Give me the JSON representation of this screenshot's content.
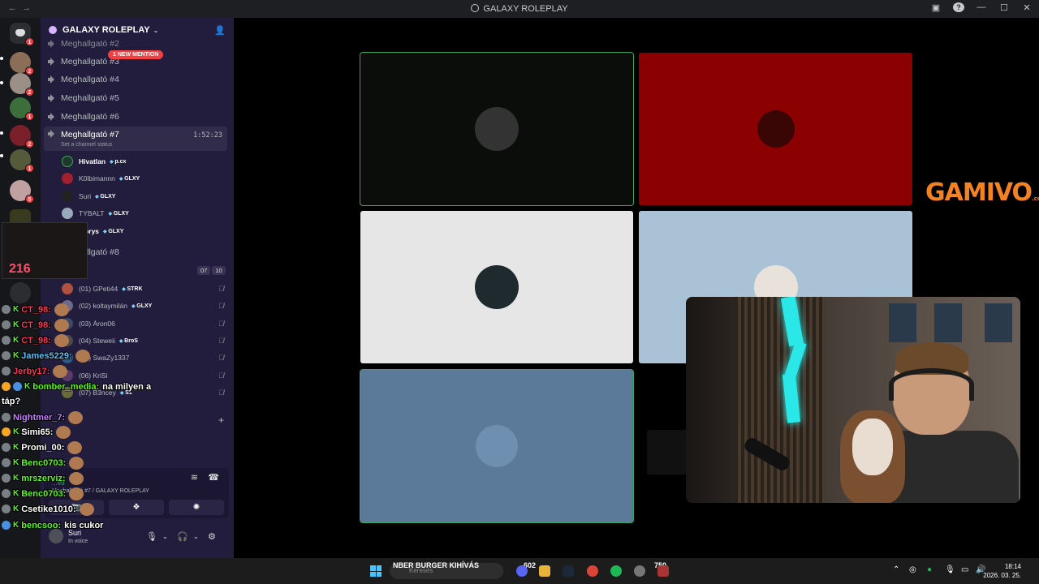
{
  "window": {
    "title": "GALAXY ROLEPLAY"
  },
  "server": {
    "name": "GALAXY ROLEPLAY",
    "new_mention": "1 NEW MENTION"
  },
  "rail": {
    "badges": [
      "1",
      "2",
      "2",
      "1",
      "2",
      "1",
      "5"
    ]
  },
  "channels": [
    {
      "name": "Meghallgató #2"
    },
    {
      "name": "Meghallgató #3"
    },
    {
      "name": "Meghallgató #4"
    },
    {
      "name": "Meghallgató #5"
    },
    {
      "name": "Meghallgató #6"
    },
    {
      "name": "Meghallgató #7",
      "time": "1:52:23",
      "status": "Set a channel status"
    },
    {
      "name": "Meghallgató #8"
    }
  ],
  "channel7_members": [
    {
      "name": "Hivatlan",
      "tag": "p.cx"
    },
    {
      "name": "K0lbimannn",
      "tag": "GLXY"
    },
    {
      "name": "Suri",
      "tag": "GLXY"
    },
    {
      "name": "TYBALT",
      "tag": "GLXY"
    },
    {
      "name": "...orys",
      "tag": "GLXY"
    }
  ],
  "channel8_counts": [
    "07",
    "10"
  ],
  "channel8_members": [
    {
      "name": "(01) GPeti44",
      "tag": "STRK"
    },
    {
      "name": "(02) koltaymilán",
      "tag": "GLXY"
    },
    {
      "name": "(03) Áron06",
      "tag": ""
    },
    {
      "name": "(04) Steweii",
      "tag": "BroS"
    },
    {
      "name": "(05) SwaZy1337",
      "tag": ""
    },
    {
      "name": "(06) KriSi",
      "tag": ""
    },
    {
      "name": "(07) B3ncey",
      "tag": "S1"
    }
  ],
  "voice_panel": {
    "connected": "...ed",
    "subtitle": "Meghallgató #7 / GALAXY ROLEPLAY"
  },
  "user": {
    "name": "Suri",
    "status": "In voice"
  },
  "chat": [
    {
      "user": "CT_98:",
      "color": "#ff3355",
      "msg": ""
    },
    {
      "user": "CT_98:",
      "color": "#ff3355",
      "msg": ""
    },
    {
      "user": "CT_98:",
      "color": "#ff3355",
      "msg": ""
    },
    {
      "user": "James5229:",
      "color": "#55c1ff",
      "msg": ""
    },
    {
      "user": "Jerby17:",
      "color": "#ff3355",
      "msg": ""
    },
    {
      "user": "bomber_media:",
      "color": "#53fc18",
      "msg": "na milyen a"
    },
    {
      "user": "táp?",
      "color": "#ffffff",
      "msg": ""
    },
    {
      "user": "Nightmer_7:",
      "color": "#c77dff",
      "msg": ""
    },
    {
      "user": "Simi65:",
      "color": "#ffffff",
      "msg": ""
    },
    {
      "user": "Promi_00:",
      "color": "#ffffff",
      "msg": ""
    },
    {
      "user": "Benc0703:",
      "color": "#53fc18",
      "msg": ""
    },
    {
      "user": "mrszerviz:",
      "color": "#53fc18",
      "msg": ""
    },
    {
      "user": "Benc0703:",
      "color": "#53fc18",
      "msg": ""
    },
    {
      "user": "Csetike1010:",
      "color": "#ffffff",
      "msg": ""
    },
    {
      "user": "bencsoo:",
      "color": "#53fc18",
      "msg": "kis cukor"
    }
  ],
  "alert": {
    "count": "216"
  },
  "brand": {
    "name": "GAMIVO",
    "suffix": ".com"
  },
  "taskbar": {
    "ticker": "NBER BURGER KIHÍVÁS",
    "search_placeholder": "Keresés",
    "counter_left": "602",
    "counter_right": "750",
    "time": "18:14",
    "date": "2026. 03. 25."
  },
  "colors": {
    "sidebar": "#221d3d",
    "speaking": "#3ba55d",
    "tile_red": "#8b0000",
    "tile_light": "#e6e6e6",
    "tile_sky": "#a9c2d6",
    "tile_slate": "#5b7a9a"
  }
}
